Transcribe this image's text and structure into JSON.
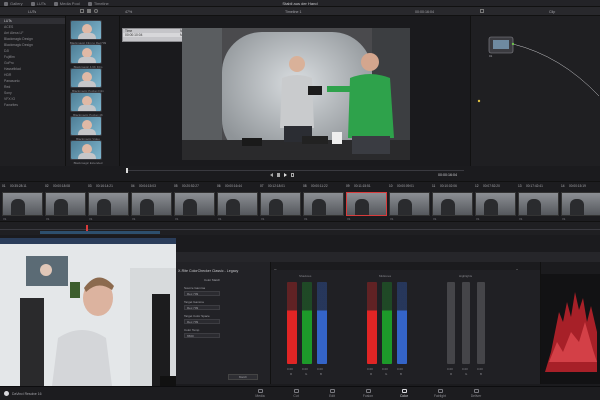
{
  "top_tabs": [
    {
      "label": "Gallery",
      "icon": "gallery-icon"
    },
    {
      "label": "LUTs",
      "icon": "luts-icon"
    },
    {
      "label": "Media Pool",
      "icon": "media-pool-icon"
    },
    {
      "label": "Timeline",
      "icon": "timeline-icon"
    }
  ],
  "project_title": "Stabil aus der Hand",
  "toolbar2": {
    "left_tab": "LUTs",
    "zoom": "47%",
    "timeline_name": "Timeline 1",
    "timecode": "00:00:16:04",
    "mode": "Clip"
  },
  "lut_tree": [
    {
      "label": "LUTs",
      "active": true
    },
    {
      "label": "ACES",
      "active": false
    },
    {
      "label": "Arri Alexa LF",
      "active": false
    },
    {
      "label": "Blackmagic Design",
      "active": false
    },
    {
      "label": "Blackmagic Design",
      "active": false
    },
    {
      "label": "DJI",
      "active": false
    },
    {
      "label": "Fujifilm",
      "active": false
    },
    {
      "label": "GoPro",
      "active": false
    },
    {
      "label": "Hasselblad",
      "active": false
    },
    {
      "label": "HDR",
      "active": false
    },
    {
      "label": "Panasonic",
      "active": false
    },
    {
      "label": "Red",
      "active": false
    },
    {
      "label": "Sony",
      "active": false
    },
    {
      "label": "VFX IO",
      "active": false
    },
    {
      "label": "Favorites",
      "active": false
    }
  ],
  "lut_thumbs": [
    {
      "caption": "Blackmagic Film to Rec709"
    },
    {
      "caption": "Blackmagic 4.6K Film"
    },
    {
      "caption": "Blackmagic Pocket Film"
    },
    {
      "caption": "Blackmagic Pocket 4K"
    },
    {
      "caption": "Blackmagic Video"
    },
    {
      "caption": "Blackmagic Extended"
    }
  ],
  "info_box": {
    "col1": "Time",
    "col2": "Name",
    "timecode": "00:00:10:04",
    "name": "Marker 1"
  },
  "viewer": {
    "timecode": "00:00:16:04",
    "node_label": "01"
  },
  "clips": [
    {
      "num": "01",
      "tc": "00:35:28:11",
      "version": "V1"
    },
    {
      "num": "02",
      "tc": "00:00:18:08",
      "version": "V1"
    },
    {
      "num": "03",
      "tc": "00:16:14:21",
      "version": "V1"
    },
    {
      "num": "04",
      "tc": "00:04:15:03",
      "version": "V1"
    },
    {
      "num": "05",
      "tc": "00:20:52:27",
      "version": "V1"
    },
    {
      "num": "06",
      "tc": "00:00:16:44",
      "version": "V1"
    },
    {
      "num": "07",
      "tc": "00:12:18:01",
      "version": "V1"
    },
    {
      "num": "08",
      "tc": "00:00:11:22",
      "version": "V1"
    },
    {
      "num": "09",
      "tc": "00:11:15:51",
      "version": "V1"
    },
    {
      "num": "10",
      "tc": "00:00:09:01",
      "version": "V1"
    },
    {
      "num": "11",
      "tc": "00:10:02:06",
      "version": "V1"
    },
    {
      "num": "12",
      "tc": "00:07:52:20",
      "version": "V1"
    },
    {
      "num": "13",
      "tc": "00:17:42:41",
      "version": "V1"
    },
    {
      "num": "14",
      "tc": "00:00:15:19",
      "version": "V1"
    }
  ],
  "cc_panel": {
    "title": "X-Rite ColorChecker Classic - Legacy",
    "section": "Color Match",
    "rows": [
      {
        "label": "Source Gamma",
        "value": "Rec 709"
      },
      {
        "label": "Target Gamma",
        "value": "Rec 709"
      },
      {
        "label": "Target Color Space",
        "value": "Rec 709"
      },
      {
        "label": "Color Temp",
        "value": "6500"
      }
    ],
    "match_button": "Match"
  },
  "wheels": {
    "tab": "Bars",
    "groups": [
      {
        "label": "Shadows",
        "values": [
          "0.00",
          "0.00",
          "0.00"
        ]
      },
      {
        "label": "Midtones",
        "values": [
          "0.00",
          "0.00",
          "0.00"
        ]
      },
      {
        "label": "Highlights",
        "values": [
          "0.00",
          "0.00",
          "0.00"
        ]
      },
      {
        "label": "Offset",
        "values": [
          "0.00",
          "0.00",
          "0.00"
        ]
      }
    ],
    "channel_labels": [
      "R",
      "G",
      "B"
    ],
    "blur_label": "Blur",
    "scopes_label": "Scopes"
  },
  "bottom_nav": [
    {
      "label": "Media",
      "active": false
    },
    {
      "label": "Cut",
      "active": false
    },
    {
      "label": "Edit",
      "active": false
    },
    {
      "label": "Fusion",
      "active": false
    },
    {
      "label": "Color",
      "active": true
    },
    {
      "label": "Fairlight",
      "active": false
    },
    {
      "label": "Deliver",
      "active": false
    }
  ],
  "app_name": "DaVinci Resolve 16",
  "colors": {
    "bg": "#1b1b1e",
    "accent_red": "#d83b3b",
    "bar_red": "#e02525",
    "bar_green": "#1d9a2a",
    "bar_blue": "#3464c8"
  }
}
